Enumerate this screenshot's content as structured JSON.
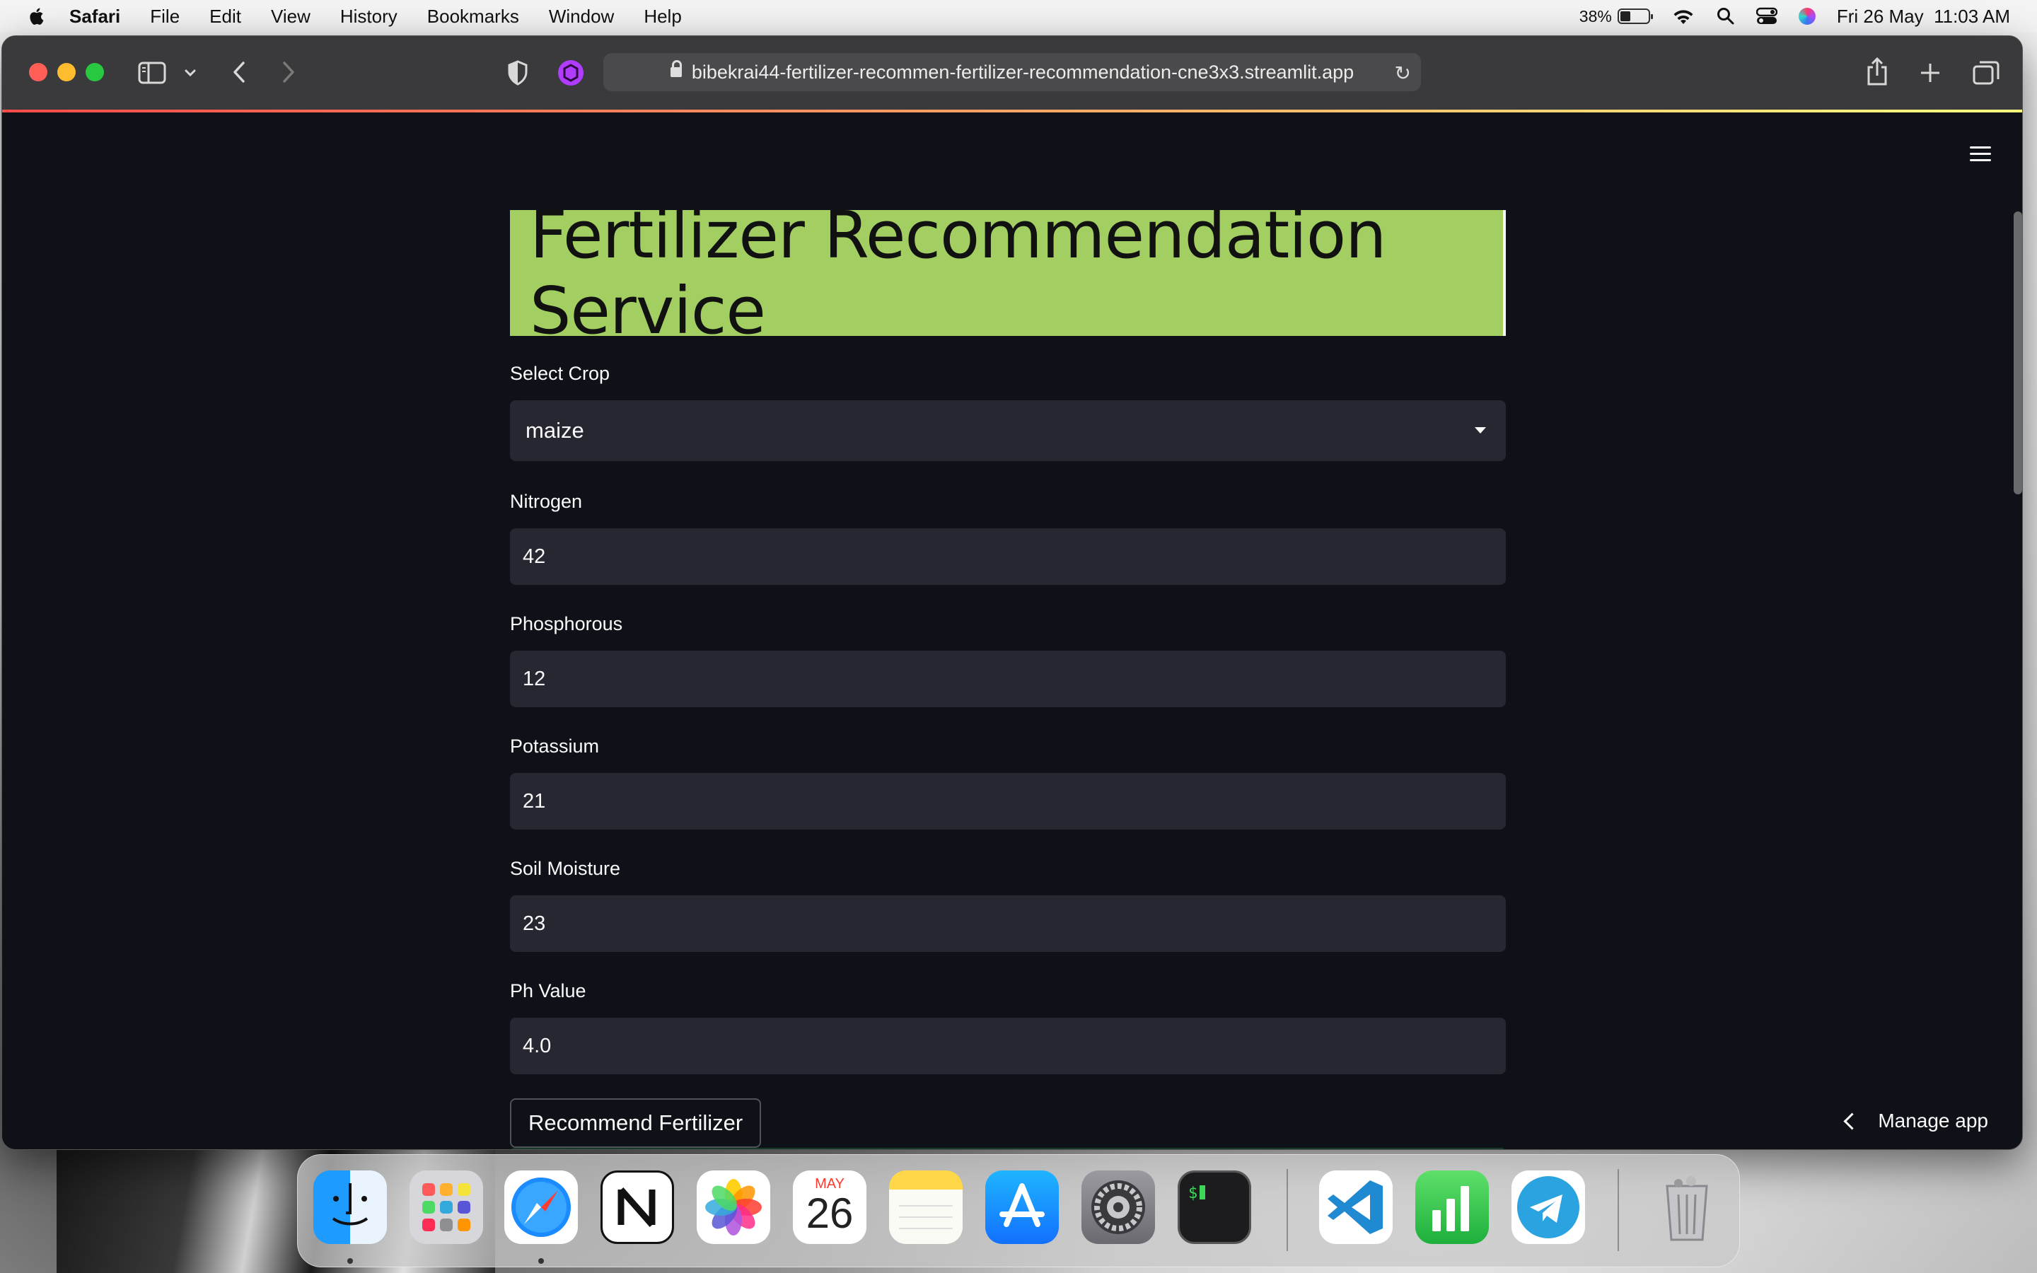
{
  "menubar": {
    "app": "Safari",
    "items": [
      "File",
      "Edit",
      "View",
      "History",
      "Bookmarks",
      "Window",
      "Help"
    ],
    "battery": "38%",
    "datetime": "Fri 26 May  11:03 AM"
  },
  "browser": {
    "url": "bibekrai44-fertilizer-recommen-fertilizer-recommendation-cne3x3.streamlit.app"
  },
  "app": {
    "title": "Fertilizer Recommendation Service",
    "crop": {
      "label": "Select Crop",
      "value": "maize"
    },
    "fields": [
      {
        "label": "Nitrogen",
        "value": "42"
      },
      {
        "label": "Phosphorous",
        "value": "12"
      },
      {
        "label": "Potassium",
        "value": "21"
      },
      {
        "label": "Soil Moisture",
        "value": "23"
      },
      {
        "label": "Ph Value",
        "value": "4.0"
      }
    ],
    "submit": "Recommend Fertilizer",
    "manage": "Manage app"
  },
  "dock": {
    "calendar_month": "MAY",
    "calendar_day": "26",
    "apps": [
      "finder-icon",
      "launchpad-icon",
      "safari-icon",
      "notion-icon",
      "photos-icon",
      "calendar-icon",
      "notes-icon",
      "app-store-icon",
      "system-settings-icon",
      "terminal-icon",
      "vscode-icon",
      "numbers-icon",
      "telegram-icon",
      "trash-icon"
    ]
  },
  "colors": {
    "banner": "#a3cf62",
    "page_bg": "#0e1117",
    "input_bg": "#262730"
  }
}
